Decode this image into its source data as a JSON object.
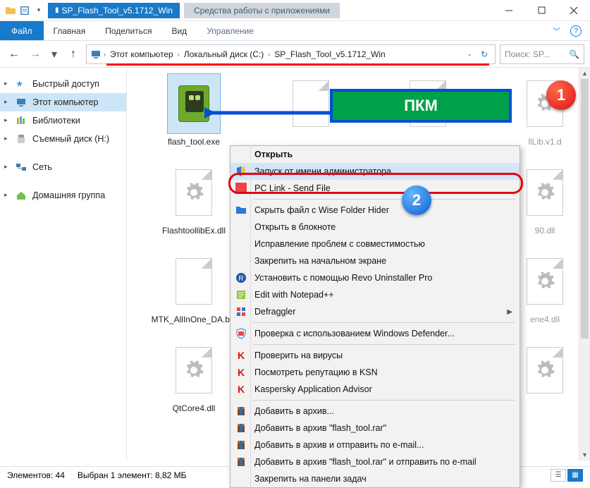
{
  "title": "SP_Flash_Tool_v5.1712_Win",
  "tools_tab": "Средства работы с приложениями",
  "ribbon": {
    "file": "Файл",
    "tabs": [
      "Главная",
      "Поделиться",
      "Вид"
    ],
    "tools": "Управление"
  },
  "breadcrumbs": {
    "items": [
      "Этот компьютер",
      "Локальный диск (C:)",
      "SP_Flash_Tool_v5.1712_Win"
    ]
  },
  "search": {
    "placeholder": "Поиск: SP..."
  },
  "sidebar": {
    "items": [
      {
        "label": "Быстрый доступ",
        "icon": "star"
      },
      {
        "label": "Этот компьютер",
        "icon": "pc",
        "selected": true
      },
      {
        "label": "Библиотеки",
        "icon": "lib"
      },
      {
        "label": "Съемный диск (H:)",
        "icon": "usb"
      },
      {
        "label": "Сеть",
        "icon": "net"
      },
      {
        "label": "Домашняя группа",
        "icon": "home"
      }
    ]
  },
  "files": {
    "items": [
      {
        "label": "flash_tool.exe",
        "type": "exe",
        "selected": true
      },
      {
        "label": "",
        "type": "page",
        "partial": true
      },
      {
        "label": "",
        "type": "page",
        "partial": true
      },
      {
        "label": "llLib.v1.d",
        "type": "gear",
        "partial": true
      },
      {
        "label": "FlashtoollibEx.dll",
        "type": "gear"
      },
      {
        "label": "",
        "type": "page",
        "partial": true
      },
      {
        "label": "",
        "type": "page",
        "partial": true
      },
      {
        "label": "90.dll",
        "type": "gear",
        "partial": true
      },
      {
        "label": "MTK_AllInOne_DA.bin",
        "type": "page"
      },
      {
        "label": "",
        "type": "page",
        "partial": true
      },
      {
        "label": "",
        "type": "page",
        "partial": true
      },
      {
        "label": "ene4.dll",
        "type": "gear",
        "partial": true
      },
      {
        "label": "QtCore4.dll",
        "type": "gear"
      },
      {
        "label": "",
        "type": "page",
        "partial": true
      },
      {
        "label": "",
        "type": "page",
        "partial": true
      },
      {
        "label": "",
        "type": "gear",
        "partial": true
      }
    ]
  },
  "context_menu": {
    "items": [
      {
        "label": "Открыть",
        "bold": true
      },
      {
        "label": "Запуск от имени администратора",
        "icon": "shield",
        "highlight": true
      },
      {
        "label": "PC Link - Send File",
        "icon": "red",
        "strike": true
      },
      {
        "sep": true
      },
      {
        "label": "Скрыть файл с Wise Folder Hider",
        "icon": "folder-blue"
      },
      {
        "label": "Открыть в блокноте"
      },
      {
        "label": "Исправление проблем с совместимостью"
      },
      {
        "label": "Закрепить на начальном экране"
      },
      {
        "label": "Установить с помощью Revo Uninstaller Pro",
        "icon": "revo"
      },
      {
        "label": "Edit with Notepad++",
        "icon": "npp"
      },
      {
        "label": "Defraggler",
        "icon": "defrag",
        "sub": true
      },
      {
        "sep": true
      },
      {
        "label": "Проверка с использованием Windows Defender...",
        "icon": "defender"
      },
      {
        "sep": true
      },
      {
        "label": "Проверить на вирусы",
        "icon": "kasp"
      },
      {
        "label": "Посмотреть репутацию в KSN",
        "icon": "kasp"
      },
      {
        "label": "Kaspersky Application Advisor",
        "icon": "kasp"
      },
      {
        "sep": true
      },
      {
        "label": "Добавить в архив...",
        "icon": "rar"
      },
      {
        "label": "Добавить в архив \"flash_tool.rar\"",
        "icon": "rar"
      },
      {
        "label": "Добавить в архив и отправить по e-mail...",
        "icon": "rar"
      },
      {
        "label": "Добавить в архив \"flash_tool.rar\" и отправить по e-mail",
        "icon": "rar"
      },
      {
        "label": "Закрепить на панели задач"
      }
    ]
  },
  "callout": {
    "pkm": "ПКМ",
    "badge1": "1",
    "badge2": "2"
  },
  "status": {
    "count_label": "Элементов: 44",
    "sel_label": "Выбран 1 элемент: 8,82 МБ"
  }
}
